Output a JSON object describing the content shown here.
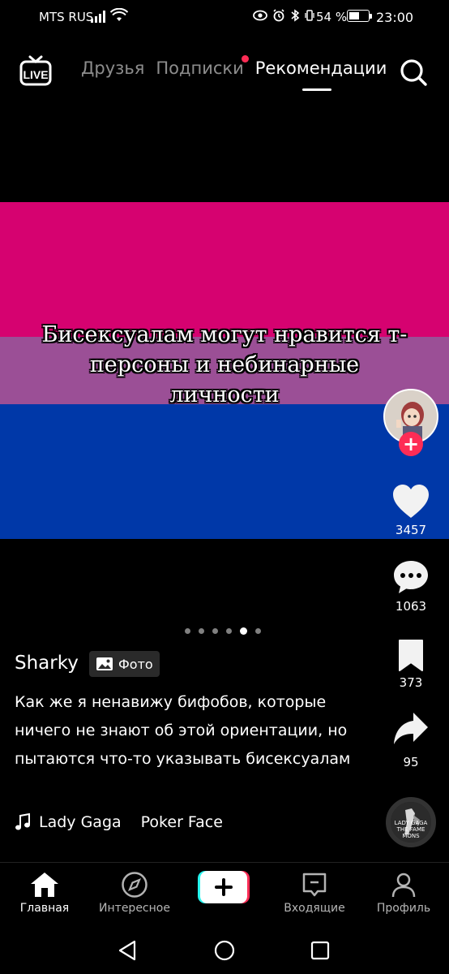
{
  "status_bar": {
    "carrier": "MTS RUS",
    "battery": "54 %",
    "time": "23:00"
  },
  "top_nav": {
    "tabs": [
      {
        "label": "Друзья"
      },
      {
        "label": "Подписки"
      },
      {
        "label": "Рекомендации"
      }
    ],
    "live_icon": "live-tv-icon",
    "search_icon": "search-icon"
  },
  "post": {
    "overlay_text": "Бисексуалам могут нравится т-персоны и небинарные личности",
    "flag_colors": [
      "#d60270",
      "#9b4f96",
      "#0038a8"
    ],
    "author": "Sharky",
    "badge": "Фото",
    "caption": "Как же я ненавижу бифобов, которые ничего не знают об этой ориентации, но пытаются что-то указывать бисексуалам",
    "sound": {
      "artist": "Lady Gaga",
      "title": "Poker Face"
    },
    "music_disc_text": "LADY GAGA THE FAME MONS",
    "carousel": {
      "count": 6,
      "active_index": 4
    }
  },
  "actions": {
    "likes": "3457",
    "comments": "1063",
    "saves": "373",
    "shares": "95"
  },
  "bottom_nav": {
    "home": "Главная",
    "discover": "Интересное",
    "inbox": "Входящие",
    "profile": "Профиль"
  },
  "colors": {
    "accent": "#fe2c55",
    "background": "#000000"
  }
}
